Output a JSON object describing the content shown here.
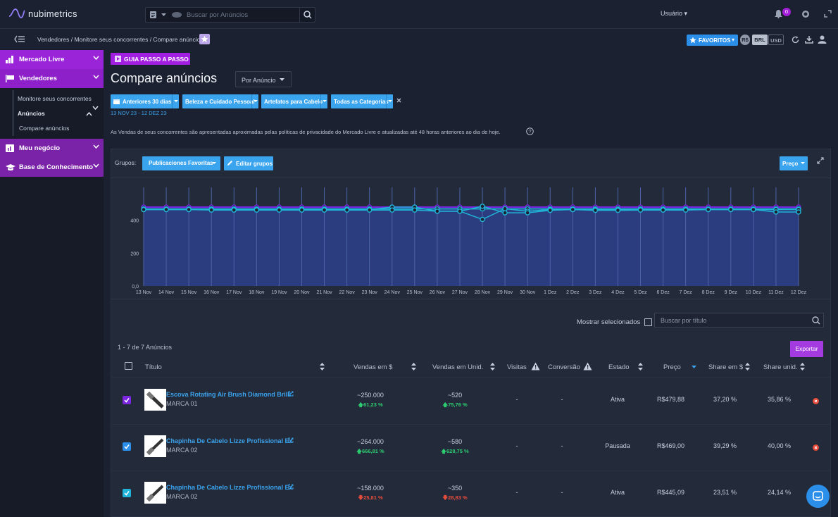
{
  "app": {
    "logo": "nubimetrics",
    "search_placeholder": "Buscar por Anúncios",
    "user_label": "Usuário",
    "notif_count": "0"
  },
  "breadcrumb": "Vendedores / Monitore seus concorrentes / Compare anúncios",
  "toolbar": {
    "favorites_label": "FAVORITOS",
    "currency_rs": "R$",
    "currency_brl": "BRL",
    "currency_usd": "USD"
  },
  "sidebar": {
    "items": [
      {
        "label": "Mercado Livre"
      },
      {
        "label": "Vendedores"
      },
      {
        "label": "Meu negócio"
      },
      {
        "label": "Base de Conhecimento"
      }
    ],
    "sub_monitor": "Monitore seus concorrentes",
    "sub_anuncios": "Anúncios",
    "sub_compare": "Compare anúncios"
  },
  "main": {
    "guide_label": "GUIA PASSO A PASSO",
    "title": "Compare anúncios",
    "view_select": "Por Anúncio",
    "filters": [
      "Anteriores 30 dias",
      "Beleza e Cuidado Pessoal",
      "Artefatos para Cabelo",
      "Todas as Categorias"
    ],
    "date_range": "13 NOV 23 - 12 DEZ 23",
    "notice": "As Vendas de seus concorrentes são apresentadas aproximadas pelas políticas de privacidade do Mercado Livre e atualizadas até 48 horas anteriores ao dia de hoje."
  },
  "panel": {
    "groups_label": "Grupos:",
    "group_value": "Publicaciones Favoritas",
    "edit_groups": "Editar grupos",
    "metric_select": "Preço"
  },
  "chart_data": {
    "type": "line",
    "x": [
      "13 Nov",
      "14 Nov",
      "15 Nov",
      "16 Nov",
      "17 Nov",
      "18 Nov",
      "19 Nov",
      "20 Nov",
      "21 Nov",
      "22 Nov",
      "23 Nov",
      "24 Nov",
      "25 Nov",
      "26 Nov",
      "27 Nov",
      "28 Nov",
      "29 Nov",
      "30 Nov",
      "1 Dez",
      "2 Dez",
      "3 Dez",
      "4 Dez",
      "5 Dez",
      "6 Dez",
      "7 Dez",
      "8 Dez",
      "9 Dez",
      "10 Dez",
      "11 Dez",
      "12 Dez"
    ],
    "y_ticks": [
      "0,0",
      "200",
      "400"
    ],
    "ylim": [
      0,
      600
    ],
    "series": [
      {
        "color": "#7a25e0",
        "values": [
          480,
          480,
          480,
          480,
          480,
          480,
          480,
          480,
          480,
          480,
          480,
          480,
          480,
          480,
          480,
          480,
          480,
          480,
          480,
          480,
          480,
          480,
          480,
          480,
          480,
          480,
          480,
          480,
          480,
          480
        ]
      },
      {
        "color": "#1fb5d8",
        "values": [
          469,
          469,
          469,
          469,
          469,
          469,
          469,
          469,
          469,
          469,
          469,
          469,
          469,
          469,
          469,
          469,
          469,
          469,
          469,
          469,
          469,
          469,
          469,
          469,
          469,
          469,
          469,
          469,
          469,
          469
        ]
      },
      {
        "color": "#1fb5d8",
        "values": [
          465,
          465,
          465,
          465,
          465,
          465,
          465,
          465,
          465,
          465,
          465,
          480,
          480,
          455,
          455,
          405,
          470,
          455,
          465,
          465,
          465,
          465,
          465,
          465,
          465,
          465,
          465,
          465,
          465,
          465
        ]
      },
      {
        "color": "#1fb5d8",
        "values": [
          465,
          465,
          465,
          462,
          462,
          462,
          462,
          462,
          462,
          462,
          462,
          462,
          462,
          455,
          455,
          485,
          445,
          445,
          460,
          465,
          460,
          460,
          462,
          462,
          462,
          465,
          465,
          465,
          450,
          450
        ]
      }
    ]
  },
  "table": {
    "filter": {
      "show_selected": "Mostrar selecionados",
      "search_placeholder": "Buscar por título"
    },
    "count_label": "1 - 7 de 7 Anúncios",
    "export_label": "Exportar",
    "headers": {
      "title": "Título",
      "vendas_r": "Vendas em $",
      "vendas_u": "Vendas em Unid.",
      "visitas": "Visitas",
      "conversao": "Conversão",
      "estado": "Estado",
      "preco": "Preço",
      "share_r": "Share em $",
      "share_u": "Share unid."
    },
    "rows": [
      {
        "title": "Escova Rotating Air Brush Diamond Brilli",
        "brand": "MARCA 01",
        "vendas_r": "~250.000",
        "vendas_r_delta": "61,23 %",
        "vendas_r_dir": "up",
        "vendas_u": "~520",
        "vendas_u_delta": "75,76 %",
        "vendas_u_dir": "up",
        "visitas": "-",
        "conversao": "-",
        "estado": "Ativa",
        "preco": "R$479,88",
        "share_r": "37,20 %",
        "share_u": "35,86 %",
        "cb_color": "#7a25e0"
      },
      {
        "title": "Chapinha De Cabelo Lizze Profissional Ex",
        "brand": "MARCA 02",
        "vendas_r": "~264.000",
        "vendas_r_delta": "666,81 %",
        "vendas_r_dir": "up",
        "vendas_u": "~580",
        "vendas_u_delta": "628,75 %",
        "vendas_u_dir": "up",
        "visitas": "-",
        "conversao": "-",
        "estado": "Pausada",
        "preco": "R$469,00",
        "share_r": "39,29 %",
        "share_u": "40,00 %",
        "cb_color": "#2b8ee8"
      },
      {
        "title": "Chapinha De Cabelo Lizze Profissional Ex",
        "brand": "MARCA 02",
        "vendas_r": "~158.000",
        "vendas_r_delta": "25,81 %",
        "vendas_r_dir": "down",
        "vendas_u": "~350",
        "vendas_u_delta": "28,83 %",
        "vendas_u_dir": "down",
        "visitas": "-",
        "conversao": "-",
        "estado": "Ativa",
        "preco": "R$445,09",
        "share_r": "23,51 %",
        "share_u": "24,14 %",
        "cb_color": "#1fb5d8"
      }
    ]
  }
}
